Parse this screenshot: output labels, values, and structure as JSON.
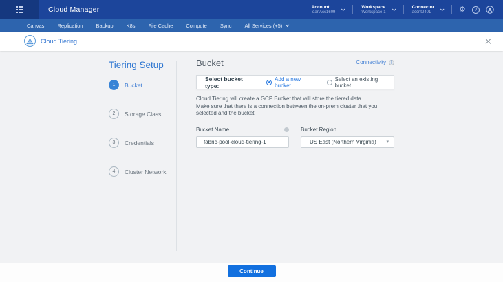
{
  "header": {
    "app_title": "Cloud Manager",
    "menus": {
      "account_label": "Account",
      "account_value": "idanAcc1609",
      "workspace_label": "Workspace",
      "workspace_value": "Workspace-1",
      "connector_label": "Connector",
      "connector_value": "accnt2401"
    },
    "help_glyph": "?"
  },
  "nav": {
    "items": [
      "Canvas",
      "Replication",
      "Backup",
      "K8s",
      "File Cache",
      "Compute",
      "Sync"
    ],
    "all_services_label": "All Services (+5)"
  },
  "service_bar": {
    "title": "Cloud Tiering"
  },
  "wizard": {
    "title": "Tiering Setup",
    "steps": [
      {
        "num": "1",
        "label": "Bucket"
      },
      {
        "num": "2",
        "label": "Storage Class"
      },
      {
        "num": "3",
        "label": "Credentials"
      },
      {
        "num": "4",
        "label": "Cluster Network"
      }
    ]
  },
  "main": {
    "heading": "Bucket",
    "connectivity_label": "Connectivity",
    "bucket_type_label": "Select bucket type:",
    "options": [
      {
        "label": "Add a new bucket"
      },
      {
        "label": "Select an existing bucket"
      }
    ],
    "description_line1": "Cloud Tiering will create a GCP Bucket that will store the tiered data.",
    "description_line2": "Make sure that there is a connection between the on-prem cluster that you selected and the bucket.",
    "bucket_name_label": "Bucket Name",
    "bucket_name_value": "fabric-pool-cloud-tiering-1",
    "bucket_region_label": "Bucket Region",
    "bucket_region_value": "US East (Northern Virginia)"
  },
  "footer": {
    "continue_label": "Continue"
  },
  "icons": {
    "gear": "⚙",
    "caret": "▾",
    "info": "i"
  },
  "colors": {
    "header_bg": "#1c459b",
    "nav_bg": "#2d64ae",
    "accent_blue": "#3b7bd3",
    "continue_button": "#1270df",
    "content_bg": "#f1f2f4"
  }
}
